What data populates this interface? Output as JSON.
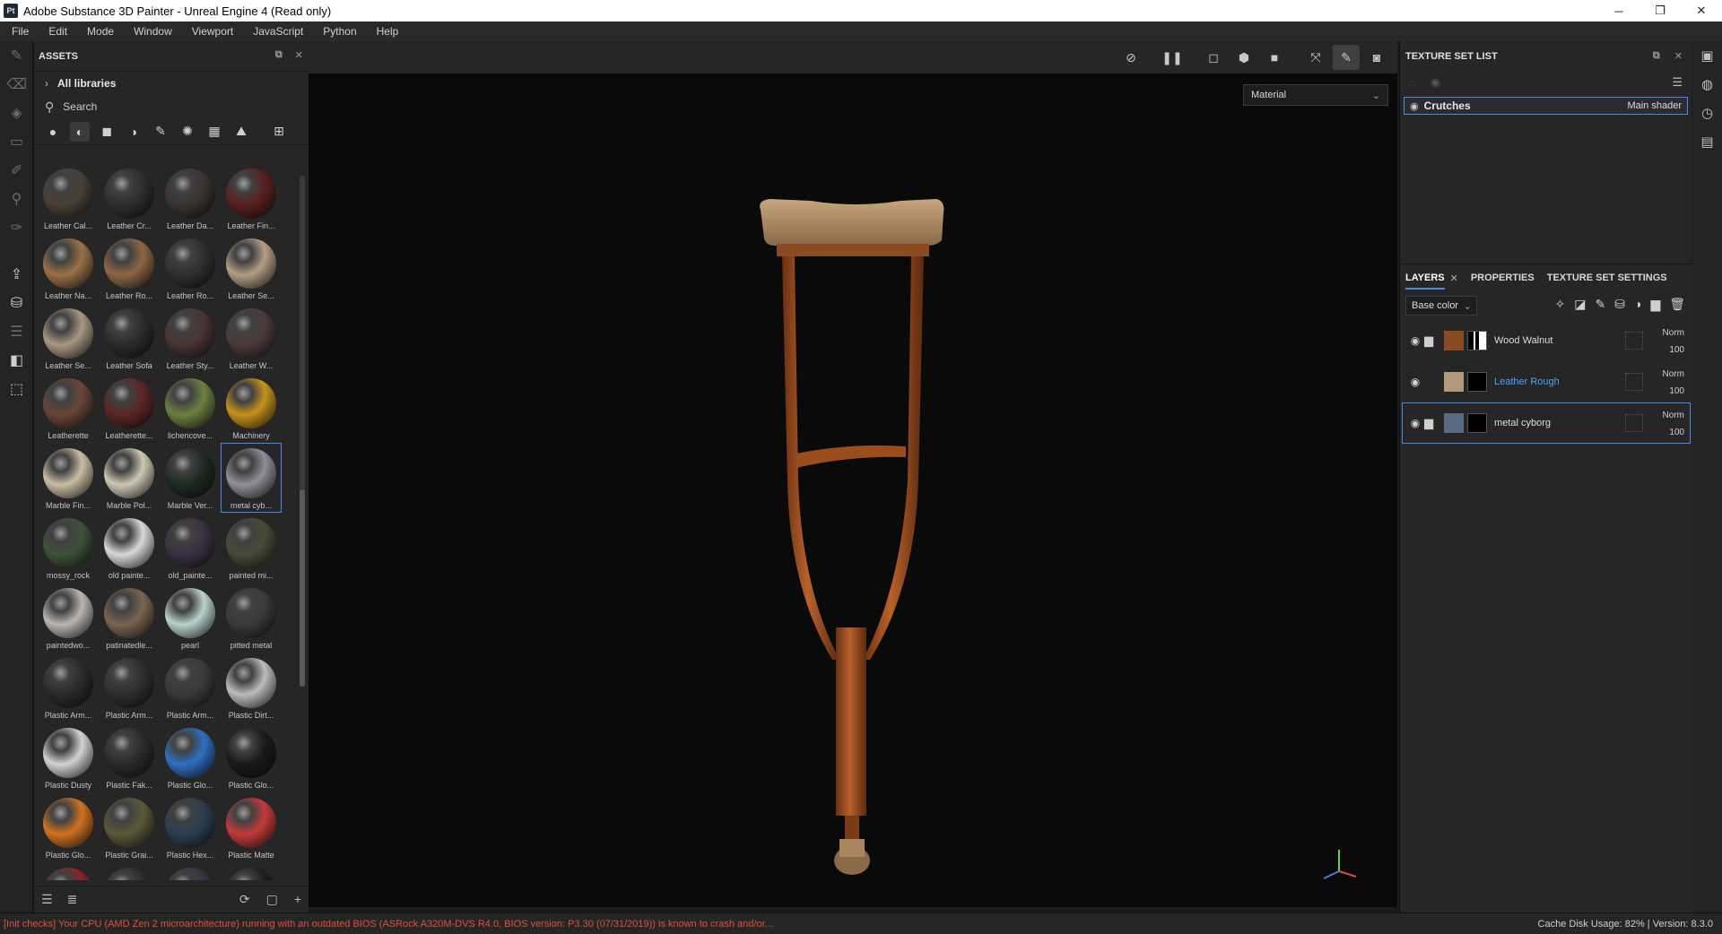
{
  "window": {
    "app_icon": "Pt",
    "title": "Adobe Substance 3D Painter - Unreal Engine 4 (Read only)"
  },
  "menu": [
    "File",
    "Edit",
    "Mode",
    "Window",
    "Viewport",
    "JavaScript",
    "Python",
    "Help"
  ],
  "assets": {
    "title": "ASSETS",
    "library": "All libraries",
    "search_placeholder": "Search",
    "materials": [
      {
        "label": "Leather Cal...",
        "color": "#4a3f35"
      },
      {
        "label": "Leather Cr...",
        "color": "#2e2e30"
      },
      {
        "label": "Leather Da...",
        "color": "#3a3330"
      },
      {
        "label": "Leather Fin...",
        "color": "#5a1f20"
      },
      {
        "label": "Leather Na...",
        "color": "#9b7148"
      },
      {
        "label": "Leather Ro...",
        "color": "#8e6644"
      },
      {
        "label": "Leather Ro...",
        "color": "#2f2f31"
      },
      {
        "label": "Leather Se...",
        "color": "#b49d84"
      },
      {
        "label": "Leather Se...",
        "color": "#a99782"
      },
      {
        "label": "Leather Sofa",
        "color": "#2b2b2d"
      },
      {
        "label": "Leather Sty...",
        "color": "#4a3333"
      },
      {
        "label": "Leather W...",
        "color": "#4b3a3a"
      },
      {
        "label": "Leatherette",
        "color": "#6a4538"
      },
      {
        "label": "Leatherette...",
        "color": "#5c2624"
      },
      {
        "label": "lichencove...",
        "color": "#6c8040"
      },
      {
        "label": "Machinery",
        "color": "#c6921c"
      },
      {
        "label": "Marble Fin...",
        "color": "#c9bea4"
      },
      {
        "label": "Marble Pol...",
        "color": "#cfc7b3"
      },
      {
        "label": "Marble Ver...",
        "color": "#1e2a22"
      },
      {
        "label": "metal cyb...",
        "color": "#8e8f99"
      },
      {
        "label": "mossy_rock",
        "color": "#3e5238"
      },
      {
        "label": "old painte...",
        "color": "#d8d8da"
      },
      {
        "label": "old_painte...",
        "color": "#3a3044"
      },
      {
        "label": "painted mi...",
        "color": "#4a4a38"
      },
      {
        "label": "paintedwo...",
        "color": "#b9b6b2"
      },
      {
        "label": "patinatedle...",
        "color": "#7a6550"
      },
      {
        "label": "pearl",
        "color": "#b8d2cc"
      },
      {
        "label": "pitted metal",
        "color": "#3a3a3c"
      },
      {
        "label": "Plastic Arm...",
        "color": "#2a2a2c"
      },
      {
        "label": "Plastic Arm...",
        "color": "#2e2e30"
      },
      {
        "label": "Plastic Arm...",
        "color": "#3a3a3c"
      },
      {
        "label": "Plastic Dirt...",
        "color": "#bcbcbc"
      },
      {
        "label": "Plastic Dusty",
        "color": "#d2d2d2"
      },
      {
        "label": "Plastic Fak...",
        "color": "#2a2a2c"
      },
      {
        "label": "Plastic Glo...",
        "color": "#2f6fc0"
      },
      {
        "label": "Plastic Glo...",
        "color": "#1a1a1a"
      },
      {
        "label": "Plastic Glo...",
        "color": "#d2721e"
      },
      {
        "label": "Plastic Grai...",
        "color": "#5c583a"
      },
      {
        "label": "Plastic Hex...",
        "color": "#2b3e52"
      },
      {
        "label": "Plastic Matte",
        "color": "#c43a3a"
      },
      {
        "label": "",
        "color": "#8a2424"
      },
      {
        "label": "",
        "color": "#2c2c2e"
      },
      {
        "label": "",
        "color": "#333345"
      },
      {
        "label": "",
        "color": "#1d1d1d"
      }
    ],
    "selected_index": 19
  },
  "viewport": {
    "display_mode": "Material"
  },
  "texture_set": {
    "title": "TEXTURE SET LIST",
    "item_name": "Crutches",
    "item_shader": "Main shader"
  },
  "layers": {
    "tabs": [
      "LAYERS",
      "PROPERTIES",
      "TEXTURE SET SETTINGS"
    ],
    "channel": "Base color",
    "items": [
      {
        "name": "Wood Walnut",
        "blend": "Norm",
        "opacity": "100",
        "thumb_color": "#8a4a22"
      },
      {
        "name": "Leather Rough",
        "blend": "Norm",
        "opacity": "100",
        "thumb_color": "#b29a7c"
      },
      {
        "name": "metal cyborg",
        "blend": "Norm",
        "opacity": "100",
        "thumb_color": "#5a6a80"
      }
    ]
  },
  "status": {
    "error": "[Init checks] Your CPU (AMD Zen 2 microarchitecture) running with an outdated BIOS (ASRock A320M-DVS R4.0, BIOS version: P3.30 (07/31/2019)) is known to crash and/or...",
    "right": "Cache Disk Usage:   82% | Version: 8.3.0"
  },
  "colors": {
    "accent": "#3d8ef0",
    "error": "#d9533a",
    "link": "#4ea3ff"
  }
}
